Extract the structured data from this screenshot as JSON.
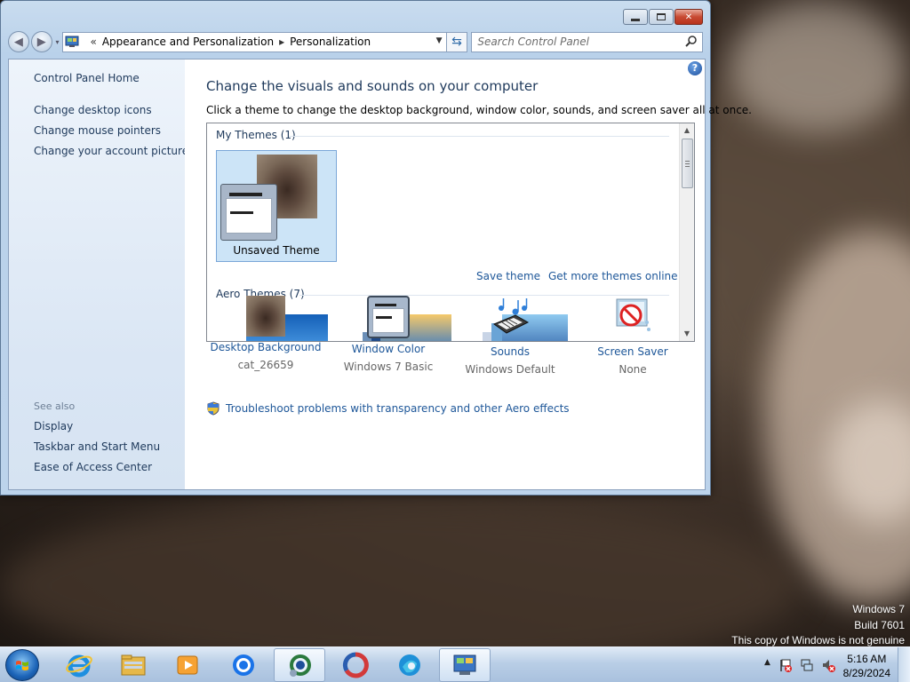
{
  "window": {
    "controls": {
      "minimize": "Minimize",
      "maximize": "Maximize",
      "close": "✕"
    },
    "address_bar": {
      "overflow": "«",
      "crumbs": [
        "Appearance and Personalization",
        "Personalization"
      ],
      "separator": "▸"
    },
    "search": {
      "placeholder": "Search Control Panel"
    }
  },
  "left_pane": {
    "home": "Control Panel Home",
    "tasks": [
      "Change desktop icons",
      "Change mouse pointers",
      "Change your account picture"
    ],
    "see_also_label": "See also",
    "see_also": [
      "Display",
      "Taskbar and Start Menu",
      "Ease of Access Center"
    ]
  },
  "main": {
    "title": "Change the visuals and sounds on your computer",
    "description": "Click a theme to change the desktop background, window color, sounds, and screen saver all at once.",
    "my_themes_header": "My Themes (1)",
    "selected_theme": "Unsaved Theme",
    "save_theme": "Save theme",
    "get_more": "Get more themes online",
    "aero_themes_header": "Aero Themes (7)",
    "settings": [
      {
        "label": "Desktop Background",
        "value": "cat_26659",
        "icon": "desktop-background-icon"
      },
      {
        "label": "Window Color",
        "value": "Windows 7 Basic",
        "icon": "window-color-icon"
      },
      {
        "label": "Sounds",
        "value": "Windows Default",
        "icon": "sounds-icon"
      },
      {
        "label": "Screen Saver",
        "value": "None",
        "icon": "screen-saver-icon"
      }
    ],
    "troubleshoot": "Troubleshoot problems with transparency and other Aero effects"
  },
  "desktop": {
    "watermark": [
      "Windows 7",
      "Build 7601",
      "This copy of Windows is not genuine"
    ]
  },
  "taskbar": {
    "items": [
      "internet-explorer",
      "file-explorer",
      "media-player",
      "chrome",
      "edge-legacy",
      "app-ring",
      "edge",
      "control-panel"
    ],
    "tray_arrow": "▲",
    "time": "5:16 AM",
    "date": "8/29/2024"
  },
  "colors": {
    "link": "#1e5799",
    "heading": "#1e395b",
    "selected_tile": "#cce4f7"
  }
}
